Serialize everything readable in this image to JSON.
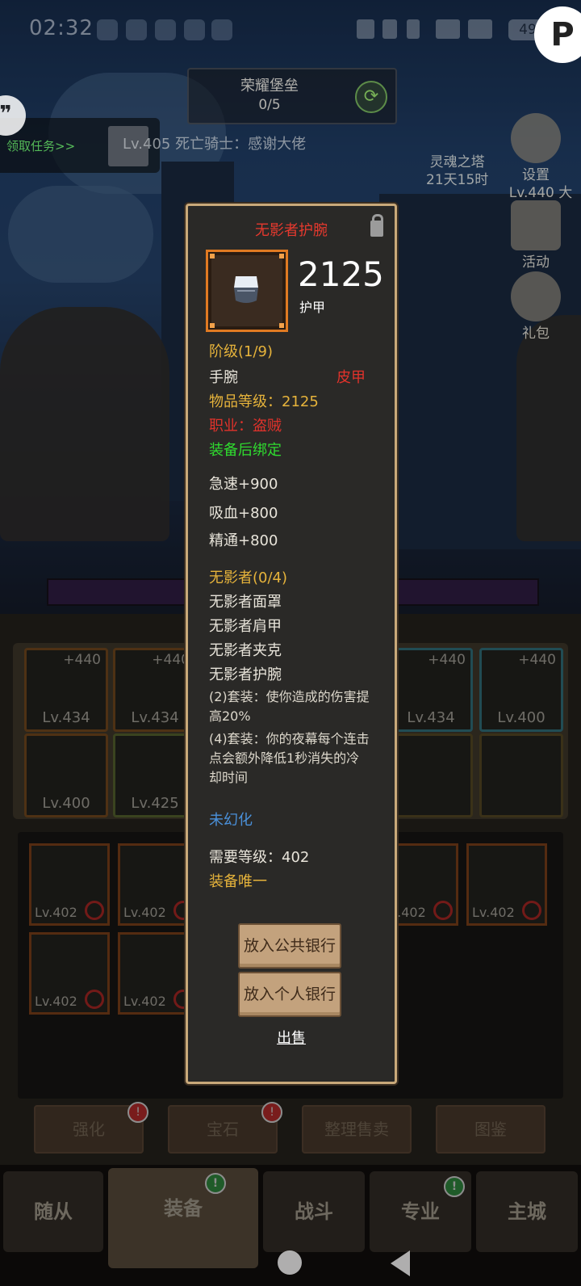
{
  "status_bar": {
    "time": "02:32",
    "battery": "49",
    "network": "5A"
  },
  "fort": {
    "title": "荣耀堡垒",
    "progress": "0/5"
  },
  "quest": {
    "link": "领取任务>>"
  },
  "broadcast": "Lv.405 死亡骑士：感谢大佬",
  "right_panel": {
    "tower_name": "灵魂之塔",
    "tower_timer": "21天15时",
    "settings_label": "设置",
    "player_level": "Lv.440 大",
    "activity_label": "活动",
    "gift_label": "礼包"
  },
  "equipment_slots": [
    {
      "level": "Lv.434",
      "plus": "+440"
    },
    {
      "level": "Lv.434",
      "plus": "+440"
    },
    {
      "level": "Lv.434",
      "plus": "+440"
    },
    {
      "level": "Lv.400",
      "plus": "+440"
    },
    {
      "level": "Lv.400"
    },
    {
      "level": "Lv.425"
    }
  ],
  "bag_slots": [
    {
      "level": "Lv.402"
    },
    {
      "level": "Lv.402"
    },
    {
      "level": "Lv.402"
    },
    {
      "level": "Lv.402"
    },
    {
      "level": "Lv.402"
    },
    {
      "level": "Lv.402"
    }
  ],
  "actions": {
    "enhance": "强化",
    "gem": "宝石",
    "sort_sell": "整理售卖",
    "codex": "图鉴"
  },
  "bottom_nav": {
    "followers": "随从",
    "equipment": "装备",
    "battle": "战斗",
    "profession": "专业",
    "main_city": "主城"
  },
  "item": {
    "name": "无影者护腕",
    "score": "2125",
    "score_label": "护甲",
    "tier": "阶级(1/9)",
    "slot": "手腕",
    "armor_type": "皮甲",
    "item_level": "物品等级：2125",
    "class_req": "职业：盗贼",
    "bind": "装备后绑定",
    "stats": [
      "急速+900",
      "吸血+800",
      "精通+800"
    ],
    "set_name": "无影者(0/4)",
    "set_pieces": [
      "无影者面罩",
      "无影者肩甲",
      "无影者夹克",
      "无影者护腕"
    ],
    "set_bonus_2": "(2)套装：使你造成的伤害提高20%",
    "set_bonus_4": "(4)套装：你的夜幕每个连击点会额外降低1秒消失的冷却时间",
    "transmog": "未幻化",
    "required_level": "需要等级：402",
    "unique": "装备唯一",
    "btn_public_bank": "放入公共银行",
    "btn_personal_bank": "放入个人银行",
    "sell": "出售",
    "colors": {
      "title": "#e6392e",
      "gold": "#e6b33b",
      "green": "#2fdc2f",
      "blue": "#4a90d9",
      "frame": "#e07a22"
    }
  }
}
